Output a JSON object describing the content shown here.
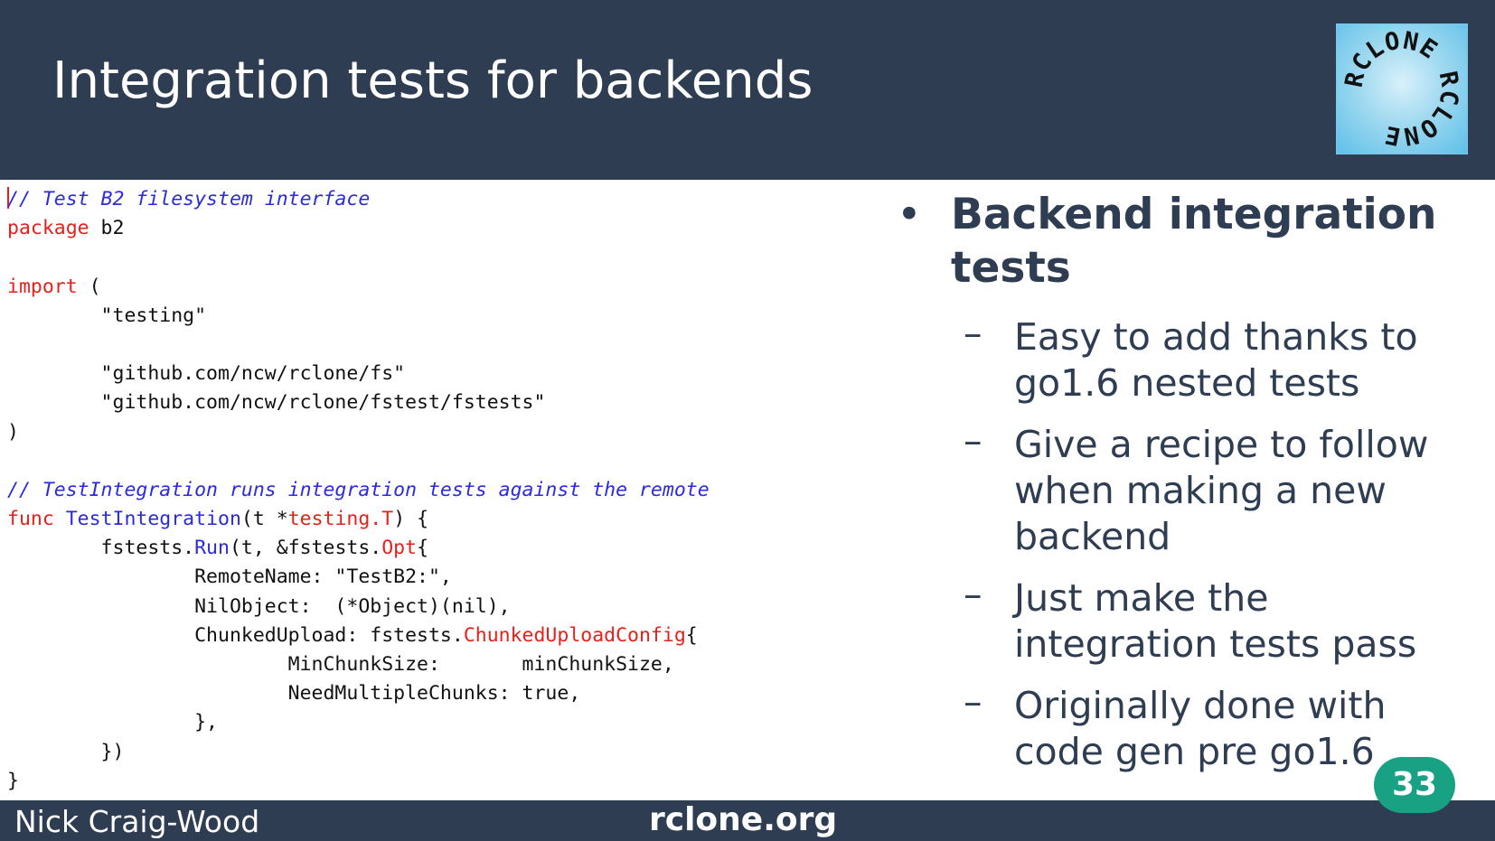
{
  "slide": {
    "title": "Integration tests for backends",
    "logo_text": "RCLONE RCLONE",
    "page_number": "33"
  },
  "code": {
    "lines": [
      [
        {
          "c": "cursor",
          "t": ""
        },
        {
          "c": "cm",
          "t": "// Test B2 filesystem interface"
        }
      ],
      [
        {
          "c": "kw",
          "t": "package"
        },
        {
          "c": "",
          "t": " b2"
        }
      ],
      [],
      [
        {
          "c": "kw",
          "t": "import"
        },
        {
          "c": "",
          "t": " ("
        }
      ],
      [
        {
          "c": "",
          "t": "        \"testing\""
        }
      ],
      [],
      [
        {
          "c": "",
          "t": "        \"github.com/ncw/rclone/fs\""
        }
      ],
      [
        {
          "c": "",
          "t": "        \"github.com/ncw/rclone/fstest/fstests\""
        }
      ],
      [
        {
          "c": "",
          "t": ")"
        }
      ],
      [],
      [
        {
          "c": "cm",
          "t": "// TestIntegration runs integration tests against the remote"
        }
      ],
      [
        {
          "c": "kw",
          "t": "func"
        },
        {
          "c": "",
          "t": " "
        },
        {
          "c": "fn",
          "t": "TestIntegration"
        },
        {
          "c": "",
          "t": "(t *"
        },
        {
          "c": "kw",
          "t": "testing.T"
        },
        {
          "c": "",
          "t": ") {"
        }
      ],
      [
        {
          "c": "",
          "t": "        fstests."
        },
        {
          "c": "fn",
          "t": "Run"
        },
        {
          "c": "",
          "t": "(t, &fstests."
        },
        {
          "c": "kw",
          "t": "Opt"
        },
        {
          "c": "",
          "t": "{"
        }
      ],
      [
        {
          "c": "",
          "t": "                RemoteName: \"TestB2:\","
        }
      ],
      [
        {
          "c": "",
          "t": "                NilObject:  (*Object)(nil),"
        }
      ],
      [
        {
          "c": "",
          "t": "                ChunkedUpload: fstests."
        },
        {
          "c": "kw",
          "t": "ChunkedUploadConfig"
        },
        {
          "c": "",
          "t": "{"
        }
      ],
      [
        {
          "c": "",
          "t": "                        MinChunkSize:       minChunkSize,"
        }
      ],
      [
        {
          "c": "",
          "t": "                        NeedMultipleChunks: true,"
        }
      ],
      [
        {
          "c": "",
          "t": "                },"
        }
      ],
      [
        {
          "c": "",
          "t": "        })"
        }
      ],
      [
        {
          "c": "",
          "t": "}"
        }
      ]
    ]
  },
  "bullets": {
    "bullet_symbol": "•",
    "dash_symbol": "–",
    "main": "Backend integration tests",
    "items": [
      "Easy to add thanks to go1.6 nested tests",
      "Give a recipe to follow when making a new backend",
      "Just make the integration tests pass",
      "Originally done with code gen pre go1.6"
    ]
  },
  "footer": {
    "author": "Nick Craig-Wood",
    "site": "rclone.org"
  },
  "colors": {
    "header_bg": "#2e3d52",
    "keyword": "#e8201b",
    "comment": "#2a2ae0",
    "badge": "#19a184",
    "bullet_text": "#2e3d52"
  }
}
